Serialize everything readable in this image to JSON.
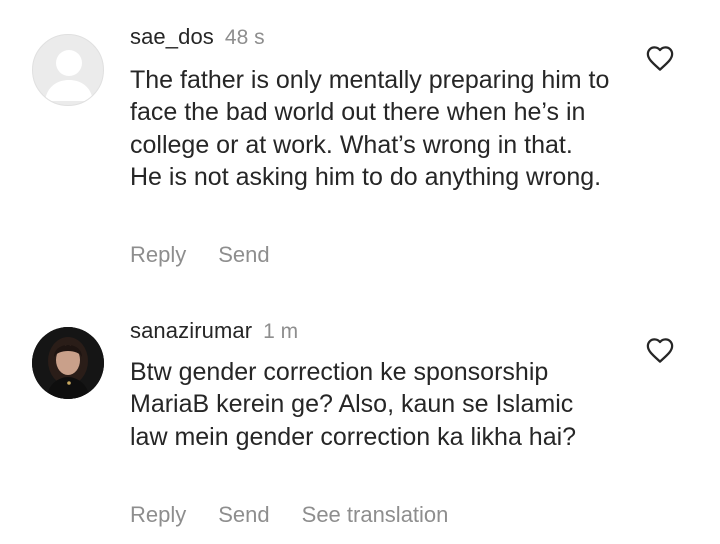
{
  "comments": [
    {
      "username": "sae_dos",
      "time": "48 s",
      "text": "The father is only mentally preparing him to face the bad world out there when he’s in college or at work. What’s wrong in that. He is not asking him to do anything wrong.",
      "actions": {
        "reply": "Reply",
        "send": "Send"
      },
      "avatar_icon": "default-avatar-icon"
    },
    {
      "username": "sanazirumar",
      "time": "1 m",
      "text": "Btw gender correction ke sponsorship MariaB kerein ge? Also, kaun se Islamic law mein gender correction ka likha hai?",
      "actions": {
        "reply": "Reply",
        "send": "Send",
        "translate": "See translation"
      },
      "avatar_icon": "profile-photo"
    }
  ],
  "icons": {
    "like": "heart-outline-icon"
  },
  "colors": {
    "text": "#262626",
    "muted": "#8e8e8e",
    "background": "#ffffff"
  }
}
